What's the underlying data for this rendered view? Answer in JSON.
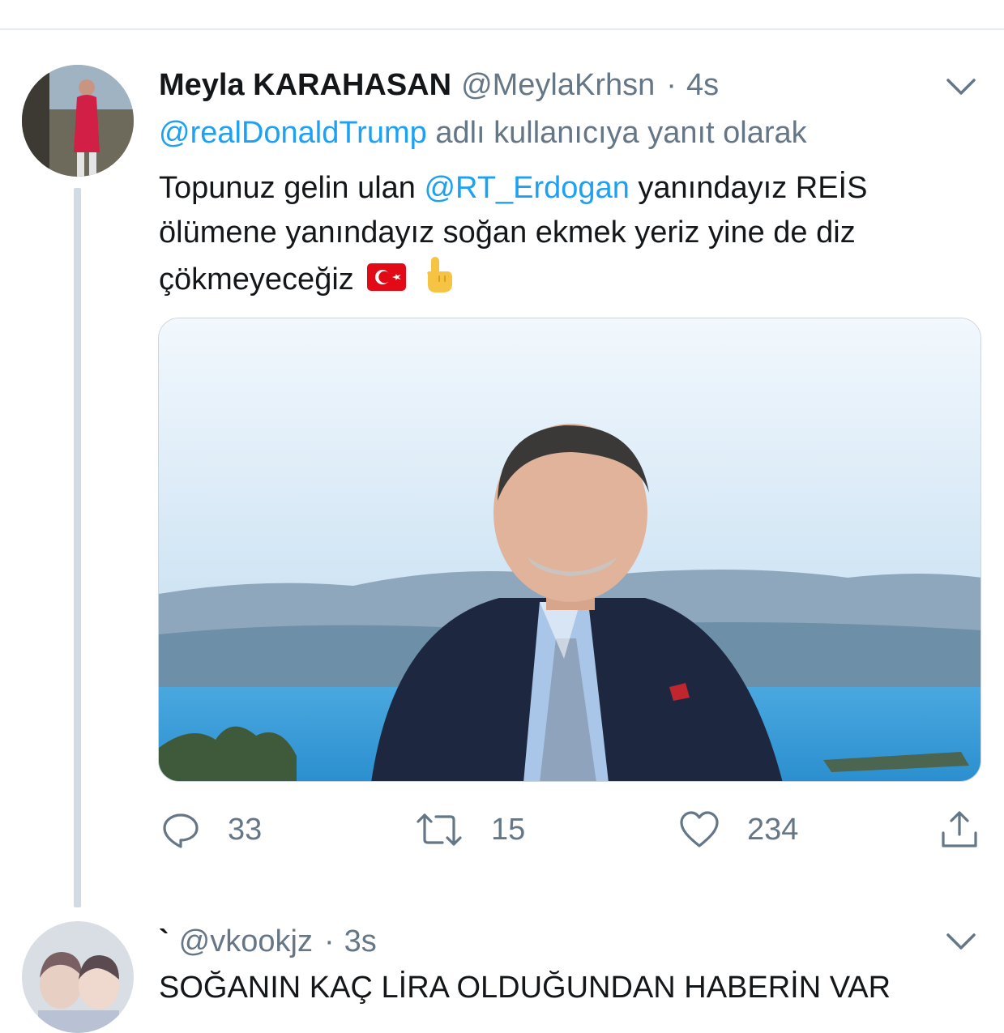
{
  "tweet1": {
    "author_name": "Meyla KARAHASAN",
    "author_handle": "@MeylaKrhsn",
    "separator": "·",
    "time": "4s",
    "reply_mention": "@realDonaldTrump",
    "reply_suffix": "adlı kullanıcıya yanıt olarak",
    "text_part1": "Topunuz gelin ulan",
    "text_mention": "@RT_Erdogan",
    "text_part2": "yanındayız REİS",
    "text_line2": "ölümene yanındayız soğan ekmek yeriz yine de diz",
    "text_line3": "çökmeyeceğiz",
    "emojis": [
      "turkey-flag",
      "pointing-up"
    ],
    "reply_count": "33",
    "retweet_count": "15",
    "like_count": "234"
  },
  "tweet2": {
    "author_name": "`",
    "author_handle": "@vkookjz",
    "separator": "·",
    "time": "3s",
    "text": "SOĞANIN KAÇ LİRA OLDUĞUNDAN HABERİN VAR"
  },
  "icons": [
    "chevron-down-icon",
    "reply-icon",
    "retweet-icon",
    "like-icon",
    "share-icon"
  ],
  "colors": {
    "link": "#1da1f2",
    "secondary_text": "#657786",
    "primary_text": "#14171a",
    "thread_line": "#d0dbe3",
    "divider": "#e6ecf0"
  }
}
